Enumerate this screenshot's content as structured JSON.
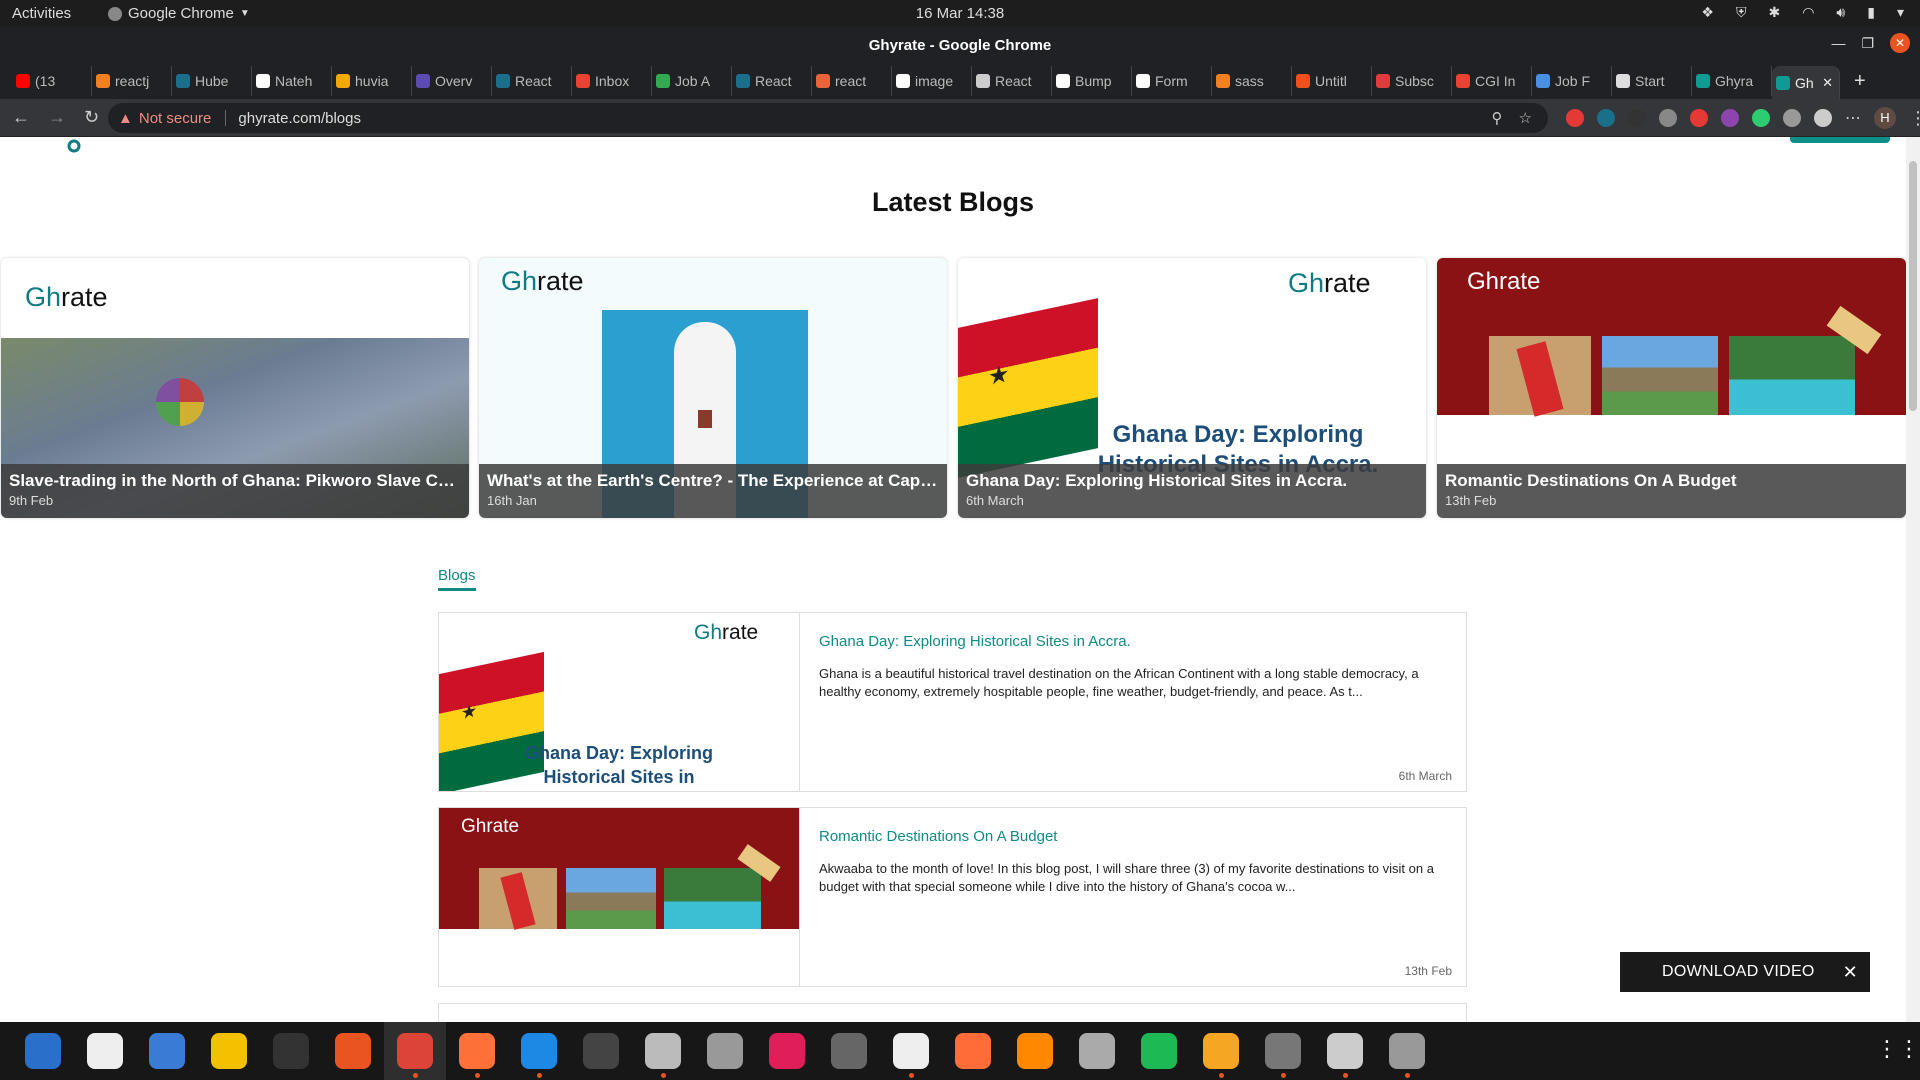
{
  "topbar": {
    "activities": "Activities",
    "app": "Google Chrome",
    "clock": "16 Mar  14:38"
  },
  "window": {
    "title": "Ghyrate - Google Chrome"
  },
  "tabs": [
    {
      "label": "(13",
      "color": "#ff0000"
    },
    {
      "label": "reactj",
      "color": "#f48024"
    },
    {
      "label": "Hube",
      "color": "#1b6f8a"
    },
    {
      "label": "Nateh",
      "color": "#ffffff"
    },
    {
      "label": "huvia",
      "color": "#f2a900"
    },
    {
      "label": "Overv",
      "color": "#5c4bb0"
    },
    {
      "label": "React",
      "color": "#1b6f8a"
    },
    {
      "label": "Inbox",
      "color": "#ea4335"
    },
    {
      "label": "Job A",
      "color": "#34a853"
    },
    {
      "label": "React",
      "color": "#1b6f8a"
    },
    {
      "label": "react",
      "color": "#e8643a"
    },
    {
      "label": "image",
      "color": "#ffffff"
    },
    {
      "label": "React",
      "color": "#cccccc"
    },
    {
      "label": "Bump",
      "color": "#ffffff"
    },
    {
      "label": "Form",
      "color": "#ffffff"
    },
    {
      "label": "sass",
      "color": "#f48024"
    },
    {
      "label": "Untitl",
      "color": "#f24e1e"
    },
    {
      "label": "Subsc",
      "color": "#e23b3b"
    },
    {
      "label": "CGI In",
      "color": "#ea4335"
    },
    {
      "label": "Job F",
      "color": "#4a90e2"
    },
    {
      "label": "Start",
      "color": "#dddddd"
    },
    {
      "label": "Ghyra",
      "color": "#0f9a93"
    }
  ],
  "active_tab": {
    "label": "Gh",
    "close": "✕"
  },
  "newtab": "+",
  "address": {
    "not_secure": "Not secure",
    "url": "ghyrate.com/blogs"
  },
  "extension_colors": [
    "#e53935",
    "#1b6f8a",
    "#333333",
    "#888888",
    "#e53935",
    "#8e44ad",
    "#2ecc71",
    "#999999",
    "#cccccc"
  ],
  "avatar": "H",
  "page": {
    "latest_heading": "Latest Blogs",
    "logo_text": "Gh",
    "logo_suffix": "rate",
    "blogs_tab": "Blogs",
    "download": "DOWNLOAD VIDEO",
    "ghana_overlay": "Ghana Day: Exploring Historical Sites in Accra.",
    "ghana_overlay_short": "Ghana Day: Exploring Historical Sites in"
  },
  "cards": [
    {
      "title": "Slave-trading in the North of Ghana: Pikworo Slave Camp",
      "date": "9th Feb"
    },
    {
      "title": "What's at the Earth's Centre? - The Experience at Cape Three Points",
      "date": "16th Jan"
    },
    {
      "title": "Ghana Day: Exploring Historical Sites in Accra.",
      "date": "6th March"
    },
    {
      "title": "Romantic Destinations On A Budget",
      "date": "13th Feb"
    }
  ],
  "blogs": [
    {
      "title": "Ghana Day: Exploring Historical Sites in Accra.",
      "excerpt": "Ghana is a beautiful historical travel destination on the African Continent with a long stable democracy, a healthy economy, extremely hospitable people, fine weather, budget-friendly, and peace. As t...",
      "date": "6th March"
    },
    {
      "title": "Romantic Destinations On A Budget",
      "excerpt": "Akwaaba to the month of love! In this blog post, I will share three (3) of my favorite destinations to visit on a budget with that special someone while I dive into the history of Ghana's cocoa w...",
      "date": "13th Feb"
    }
  ],
  "dock": [
    {
      "name": "writer",
      "color": "#2a6fc9"
    },
    {
      "name": "kde",
      "color": "#eeeeee"
    },
    {
      "name": "thunderbird",
      "color": "#3a7bd5"
    },
    {
      "name": "rhythmbox",
      "color": "#f2c200"
    },
    {
      "name": "terminal",
      "color": "#333333"
    },
    {
      "name": "software",
      "color": "#e95420"
    },
    {
      "name": "chrome",
      "color": "#db4437"
    },
    {
      "name": "firefox",
      "color": "#ff7139"
    },
    {
      "name": "vscode",
      "color": "#1e88e5"
    },
    {
      "name": "monitor",
      "color": "#444444"
    },
    {
      "name": "files",
      "color": "#bbbbbb"
    },
    {
      "name": "postman",
      "color": "#999999"
    },
    {
      "name": "slack",
      "color": "#e01e5a"
    },
    {
      "name": "react",
      "color": "#666666"
    },
    {
      "name": "downloader",
      "color": "#eeeeee"
    },
    {
      "name": "postman-orange",
      "color": "#ff6c37"
    },
    {
      "name": "vlc",
      "color": "#ff8800"
    },
    {
      "name": "archive",
      "color": "#aaaaaa"
    },
    {
      "name": "spotify",
      "color": "#1db954"
    },
    {
      "name": "calculator",
      "color": "#f5a623"
    },
    {
      "name": "settings",
      "color": "#777777"
    },
    {
      "name": "screenshot",
      "color": "#cccccc"
    },
    {
      "name": "disk",
      "color": "#999999"
    }
  ]
}
